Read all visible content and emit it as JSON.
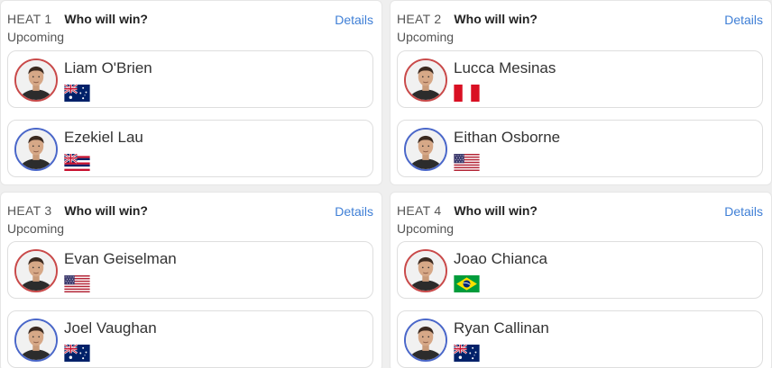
{
  "heats": [
    {
      "heat_label": "HEAT 1",
      "question": "Who will win?",
      "status": "Upcoming",
      "details_label": "Details",
      "athletes": [
        {
          "name": "Liam O'Brien",
          "flag_icon": "australia-flag-icon",
          "ring_color": "#c94a4a"
        },
        {
          "name": "Ezekiel Lau",
          "flag_icon": "hawaii-flag-icon",
          "ring_color": "#4a67c9"
        }
      ]
    },
    {
      "heat_label": "HEAT 2",
      "question": "Who will win?",
      "status": "Upcoming",
      "details_label": "Details",
      "athletes": [
        {
          "name": "Lucca Mesinas",
          "flag_icon": "peru-flag-icon",
          "ring_color": "#c94a4a"
        },
        {
          "name": "Eithan Osborne",
          "flag_icon": "usa-flag-icon",
          "ring_color": "#4a67c9"
        }
      ]
    },
    {
      "heat_label": "HEAT 3",
      "question": "Who will win?",
      "status": "Upcoming",
      "details_label": "Details",
      "athletes": [
        {
          "name": "Evan Geiselman",
          "flag_icon": "usa-flag-icon",
          "ring_color": "#c94a4a"
        },
        {
          "name": "Joel Vaughan",
          "flag_icon": "australia-flag-icon",
          "ring_color": "#4a67c9"
        }
      ]
    },
    {
      "heat_label": "HEAT 4",
      "question": "Who will win?",
      "status": "Upcoming",
      "details_label": "Details",
      "athletes": [
        {
          "name": "Joao Chianca",
          "flag_icon": "brazil-flag-icon",
          "ring_color": "#c94a4a"
        },
        {
          "name": "Ryan Callinan",
          "flag_icon": "australia-flag-icon",
          "ring_color": "#4a67c9"
        }
      ]
    }
  ]
}
